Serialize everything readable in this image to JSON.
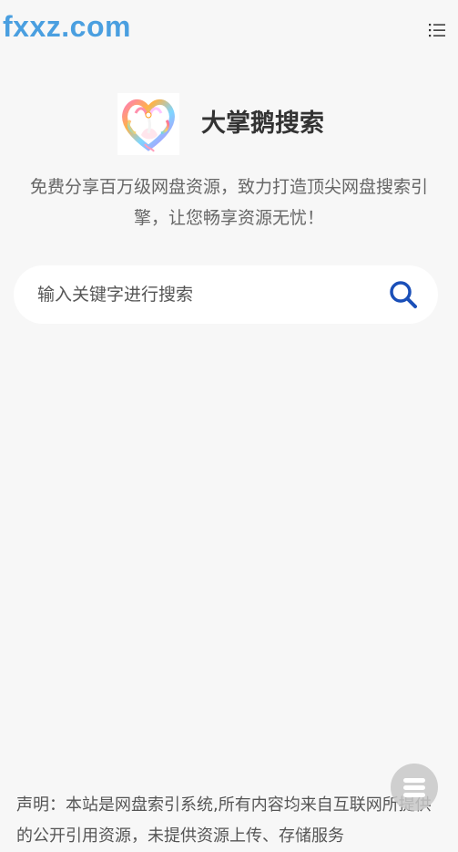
{
  "site": {
    "logo_text": "fxxz.com"
  },
  "header": {
    "menu_icon": "list-menu-icon"
  },
  "brand": {
    "title": "大掌鹅搜索",
    "logo_icon": "swan-heart-logo"
  },
  "tagline": "免费分享百万级网盘资源，致力打造顶尖网盘搜索引擎，让您畅享资源无忧！",
  "search": {
    "placeholder": "输入关键字进行搜索",
    "value": "",
    "button_icon": "search-icon"
  },
  "footer": {
    "disclaimer": "声明：本站是网盘索引系统,所有内容均来自互联网所提供的公开引用资源，未提供资源上传、存储服务"
  },
  "float_button": {
    "icon": "menu-icon"
  },
  "colors": {
    "logo_blue": "#4a9fe0",
    "search_blue": "#1a4fb8",
    "background": "#f7f7f7"
  }
}
